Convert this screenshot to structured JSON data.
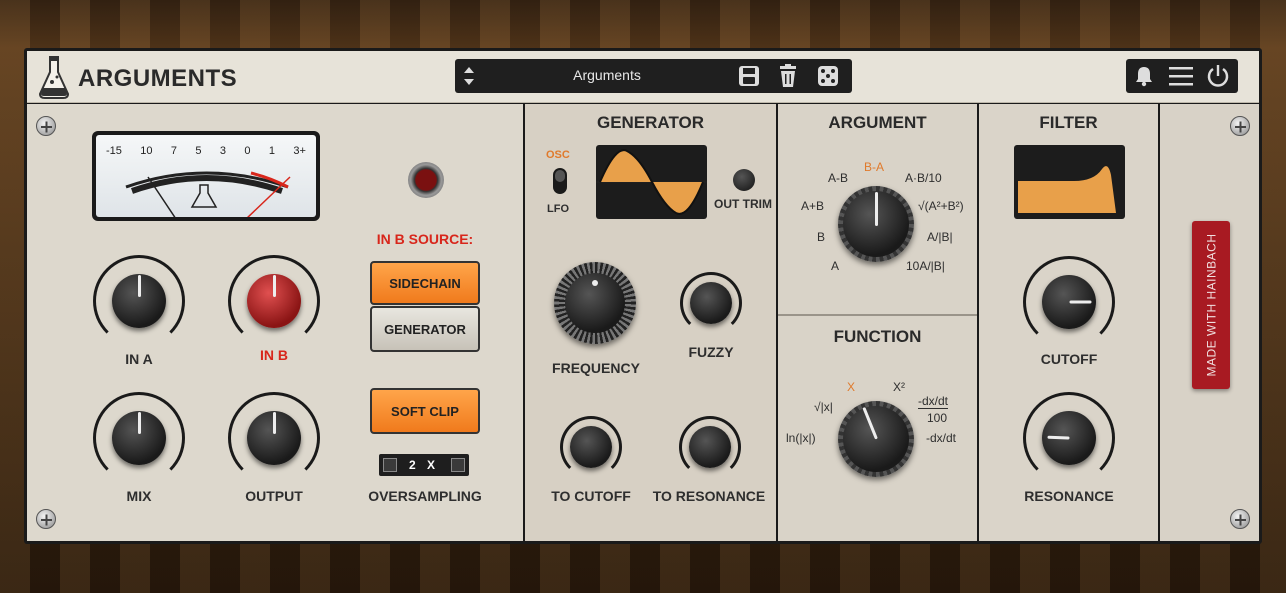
{
  "header": {
    "app_title": "ARGUMENTS",
    "preset_name": "Arguments"
  },
  "input_section": {
    "vu_scale": [
      "-15",
      "10",
      "7",
      "5",
      "3",
      "0",
      "1",
      "3+"
    ],
    "in_b_source_label": "IN B SOURCE:",
    "sidechain_label": "SIDECHAIN",
    "generator_label": "GENERATOR",
    "soft_clip_label": "SOFT CLIP",
    "oversampling_value": "2 X",
    "oversampling_label": "OVERSAMPLING",
    "knobs": {
      "in_a": "IN A",
      "in_b": "IN B",
      "mix": "MIX",
      "output": "OUTPUT"
    }
  },
  "generator": {
    "title": "GENERATOR",
    "osc_label": "OSC",
    "lfo_label": "LFO",
    "out_trim_label": "OUT TRIM",
    "frequency_label": "FREQUENCY",
    "fuzzy_label": "FUZZY",
    "to_cutoff_label": "TO CUTOFF",
    "to_resonance_label": "TO RESONANCE"
  },
  "argument": {
    "title": "ARGUMENT",
    "options": [
      "B-A",
      "A-B",
      "A·B/10",
      "A+B",
      "√(A²+B²)",
      "B",
      "A/|B|",
      "A",
      "10A/|B|"
    ],
    "selected": "B-A"
  },
  "function": {
    "title": "FUNCTION",
    "options": [
      "X",
      "X²",
      "√|x|",
      "-dx/dt",
      "100",
      "ln(|x|)",
      "-dx/dt"
    ],
    "selected": "X"
  },
  "filter": {
    "title": "FILTER",
    "cutoff_label": "CUTOFF",
    "resonance_label": "RESONANCE"
  },
  "side_badge": "MADE WITH HAINBACH",
  "colors": {
    "accent_orange": "#f07a1c",
    "accent_red": "#d8261b",
    "panel": "#dcd6cb",
    "display_orange": "#e8a04a"
  }
}
